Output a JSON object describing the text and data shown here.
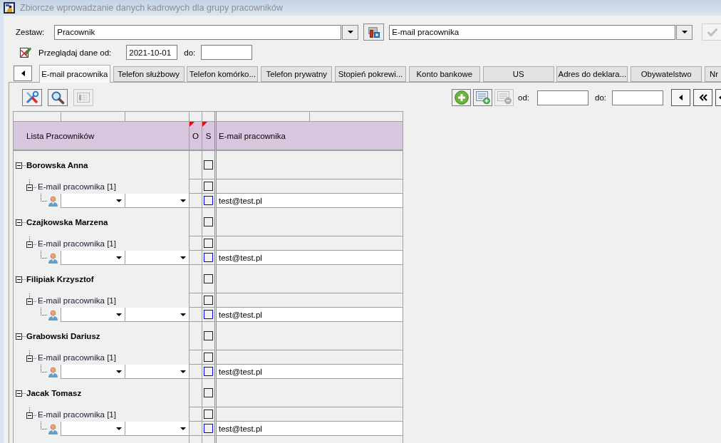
{
  "window": {
    "title": "Zbiorcze wprowadzanie danych kadrowych dla grupy pracowników"
  },
  "set_selector": {
    "label": "Zestaw:",
    "value": "Pracownik"
  },
  "field_selector": {
    "value": "E-mail pracownika"
  },
  "apply_button": {
    "disabled": true
  },
  "date_filter": {
    "label": "Przeglądaj dane od:",
    "from_value": "2021-10-01",
    "to_label": "do:"
  },
  "tabs": [
    {
      "label": "E-mail pracownika",
      "selected": true
    },
    {
      "label": "Telefon służbowy",
      "selected": false
    },
    {
      "label": "Telefon komórko...",
      "selected": false
    },
    {
      "label": "Telefon prywatny",
      "selected": false
    },
    {
      "label": "Stopień pokrewi...",
      "selected": false
    },
    {
      "label": "Konto bankowe",
      "selected": false
    },
    {
      "label": "US",
      "selected": false
    },
    {
      "label": "Adres do deklara...",
      "selected": false
    },
    {
      "label": "Obywatelstwo",
      "selected": false
    },
    {
      "label": "Nr",
      "selected": false
    }
  ],
  "grid_toolbar": {
    "tools": [
      {
        "kind": "tools",
        "disabled": false
      },
      {
        "kind": "search",
        "disabled": false
      },
      {
        "kind": "numbering",
        "disabled": true
      }
    ],
    "record_tools": [
      {
        "kind": "add",
        "disabled": false
      },
      {
        "kind": "add_row",
        "disabled": false
      },
      {
        "kind": "remove_row",
        "disabled": true
      }
    ],
    "from_label": "od:",
    "to_label": "do:"
  },
  "grid": {
    "columns": [
      {
        "label": "Lista Pracowników",
        "flagged": false
      },
      {
        "label": "O",
        "flagged": true
      },
      {
        "label": "S",
        "flagged": true
      },
      {
        "label": "E-mail pracownika",
        "flagged": false
      }
    ],
    "employees": [
      {
        "name": "Borowska Anna",
        "expanded": true,
        "checked": false,
        "children": [
          {
            "label": "E-mail pracownika [1]",
            "expanded": true,
            "checked": false,
            "children": [
              {
                "email": "test@test.pl",
                "checked": false
              }
            ]
          }
        ]
      },
      {
        "name": "Czajkowska Marzena",
        "expanded": true,
        "checked": false,
        "children": [
          {
            "label": "E-mail pracownika [1]",
            "expanded": true,
            "checked": false,
            "children": [
              {
                "email": "test@test.pl",
                "checked": false
              }
            ]
          }
        ]
      },
      {
        "name": "Filipiak Krzysztof",
        "expanded": true,
        "checked": false,
        "children": [
          {
            "label": "E-mail pracownika [1]",
            "expanded": true,
            "checked": false,
            "children": [
              {
                "email": "test@test.pl",
                "checked": false
              }
            ]
          }
        ]
      },
      {
        "name": "Grabowski Dariusz",
        "expanded": true,
        "checked": false,
        "children": [
          {
            "label": "E-mail pracownika [1]",
            "expanded": true,
            "checked": false,
            "children": [
              {
                "email": "test@test.pl",
                "checked": false
              }
            ]
          }
        ]
      },
      {
        "name": "Jacak Tomasz",
        "expanded": true,
        "checked": false,
        "children": [
          {
            "label": "E-mail pracownika [1]",
            "expanded": true,
            "checked": false,
            "children": [
              {
                "email": "test@test.pl",
                "checked": false
              }
            ]
          }
        ]
      }
    ]
  }
}
